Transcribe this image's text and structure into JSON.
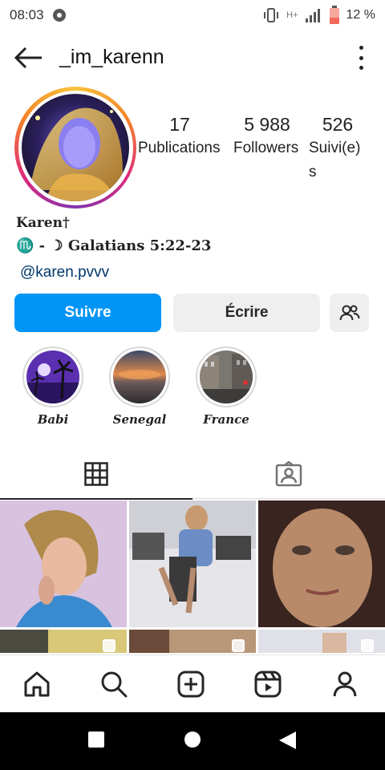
{
  "status_bar": {
    "time": "08:03",
    "network": "H+",
    "battery_pct": "12 %"
  },
  "header": {
    "username": "_im_karenn",
    "back_icon": "arrow-left-icon",
    "menu_icon": "kebab-menu-icon"
  },
  "profile": {
    "stats": [
      {
        "value": "17",
        "label": "Publications"
      },
      {
        "value": "5 988",
        "label": "Followers"
      },
      {
        "value": "526",
        "label": "Suivi(e)s"
      }
    ],
    "name": "Karen†",
    "bio_line": "♏ - ☽  Galatians 5:22-23",
    "mention": "@karen.pvvv"
  },
  "actions": {
    "follow_label": "Suivre",
    "message_label": "Écrire",
    "suggest_icon": "add-person-icon"
  },
  "highlights": [
    {
      "label": "Babi"
    },
    {
      "label": "Senegal"
    },
    {
      "label": "France"
    }
  ],
  "tabs": [
    {
      "icon": "grid-icon",
      "active": true
    },
    {
      "icon": "tagged-icon",
      "active": false
    }
  ],
  "bottom_nav": [
    "home-icon",
    "search-icon",
    "create-icon",
    "reels-icon",
    "profile-icon"
  ],
  "colors": {
    "accent": "#0095f6",
    "button_secondary": "#efefef",
    "link": "#00376b",
    "text": "#262626"
  }
}
